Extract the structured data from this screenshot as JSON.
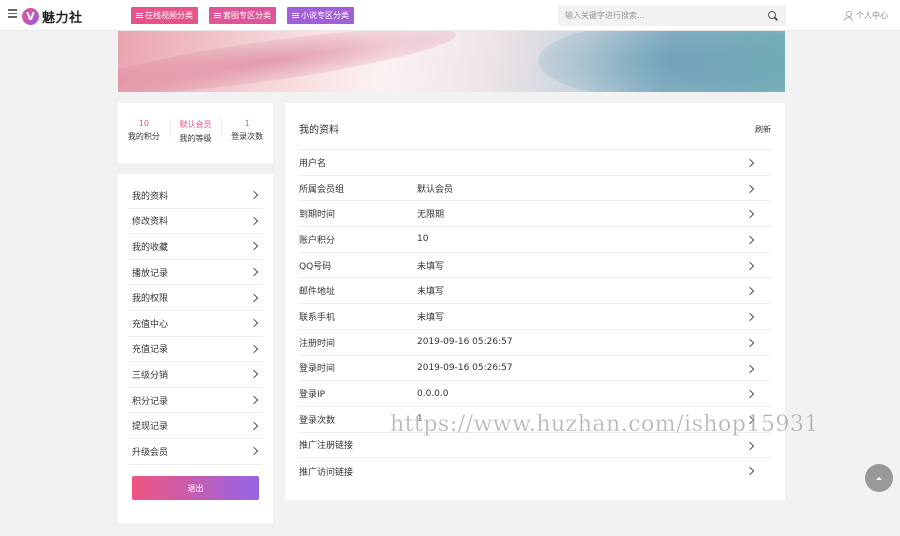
{
  "header": {
    "logo_mark": "V",
    "logo_text": "魅力社",
    "nav": [
      {
        "label": "在线视频分类",
        "color": "#e8548a"
      },
      {
        "label": "套图专区分类",
        "color": "#e0559a"
      },
      {
        "label": "小说专区分类",
        "color": "#a160d8"
      }
    ],
    "search_placeholder": "输入关键字进行搜索...",
    "user_center": "个人中心"
  },
  "stats": [
    {
      "value": "10",
      "label": "我的积分"
    },
    {
      "value": "默认会员",
      "label": "我的等级"
    },
    {
      "value": "1",
      "label": "登录次数"
    }
  ],
  "sidebar": {
    "items": [
      {
        "label": "我的资料"
      },
      {
        "label": "修改资料"
      },
      {
        "label": "我的收藏"
      },
      {
        "label": "播放记录"
      },
      {
        "label": "我的权限"
      },
      {
        "label": "充值中心"
      },
      {
        "label": "充值记录"
      },
      {
        "label": "三级分销"
      },
      {
        "label": "积分记录"
      },
      {
        "label": "提现记录"
      },
      {
        "label": "升级会员"
      }
    ],
    "logout": "退出"
  },
  "profile": {
    "title": "我的资料",
    "refresh": "刷新",
    "rows": [
      {
        "label": "用户名",
        "value": ""
      },
      {
        "label": "所属会员组",
        "value": "默认会员"
      },
      {
        "label": "到期时间",
        "value": "无限期"
      },
      {
        "label": "账户积分",
        "value": "10"
      },
      {
        "label": "QQ号码",
        "value": "未填写"
      },
      {
        "label": "邮件地址",
        "value": "未填写"
      },
      {
        "label": "联系手机",
        "value": "未填写"
      },
      {
        "label": "注册时间",
        "value": "2019-09-16 05:26:57"
      },
      {
        "label": "登录时间",
        "value": "2019-09-16 05:26:57"
      },
      {
        "label": "登录IP",
        "value": "0.0.0.0"
      },
      {
        "label": "登录次数",
        "value": "1"
      },
      {
        "label": "推广注册链接",
        "value": ""
      },
      {
        "label": "推广访问链接",
        "value": ""
      }
    ]
  },
  "watermark": "https://www.huzhan.com/ishop15931"
}
